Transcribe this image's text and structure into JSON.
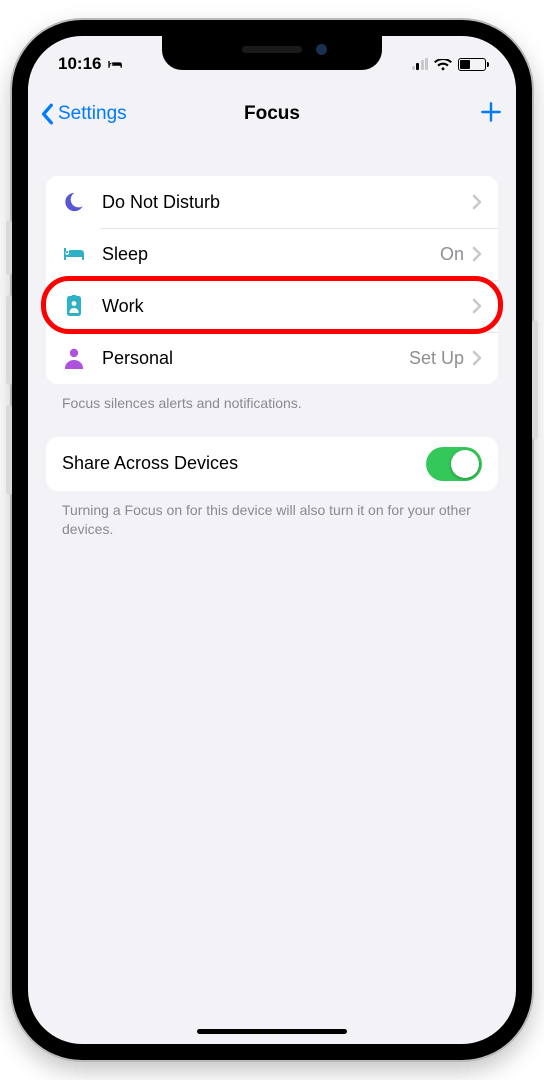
{
  "status": {
    "time": "10:16"
  },
  "nav": {
    "back_label": "Settings",
    "title": "Focus"
  },
  "focus_list": {
    "items": [
      {
        "label": "Do Not Disturb",
        "value": "",
        "icon": "moon",
        "icon_color": "#5856d6"
      },
      {
        "label": "Sleep",
        "value": "On",
        "icon": "bed",
        "icon_color": "#30b0c7"
      },
      {
        "label": "Work",
        "value": "",
        "icon": "badge",
        "icon_color": "#30b0c7"
      },
      {
        "label": "Personal",
        "value": "Set Up",
        "icon": "person",
        "icon_color": "#af52de"
      }
    ],
    "footer": "Focus silences alerts and notifications."
  },
  "share": {
    "label": "Share Across Devices",
    "enabled": true,
    "footer": "Turning a Focus on for this device will also turn it on for your other devices."
  },
  "highlight_index": 2
}
